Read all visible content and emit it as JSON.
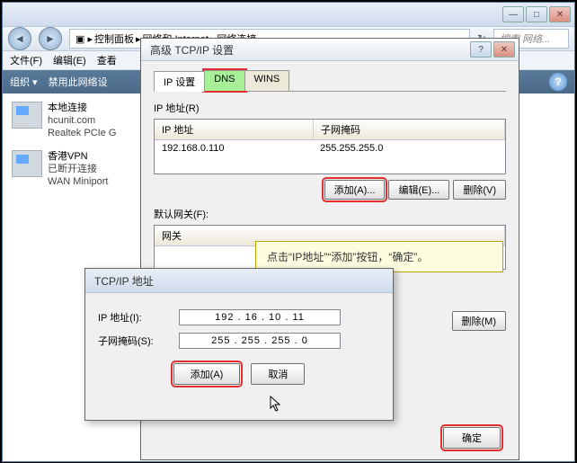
{
  "outer": {
    "crumb": [
      "控制面板",
      "网络和 Internet",
      "网络连接"
    ],
    "search": "搜索 网络...",
    "menus": [
      "文件(F)",
      "编辑(E)",
      "查看"
    ],
    "cmd": [
      "组织 ▾",
      "禁用此网络设"
    ]
  },
  "conns": [
    {
      "name": "本地连接",
      "l1": "hcunit.com",
      "l2": "Realtek PCIe G"
    },
    {
      "name": "香港VPN",
      "l1": "已断开连接",
      "l2": "WAN Miniport"
    }
  ],
  "dlg1": {
    "title": "高级 TCP/IP 设置",
    "tabs": [
      "IP 设置",
      "DNS",
      "WINS"
    ],
    "grp1": "IP 地址(R)",
    "col1": "IP 地址",
    "col2": "子网掩码",
    "ip": "192.168.0.110",
    "mask": "255.255.255.0",
    "btns": [
      "添加(A)...",
      "编辑(E)...",
      "删除(V)"
    ],
    "grp2": "默认网关(F):",
    "gwcol": "网关",
    "gwbtn": "删除(M)",
    "ok": "确定"
  },
  "callout": "点击“IP地址”“添加”按钮，“确定”。",
  "dlg2": {
    "title": "TCP/IP 地址",
    "f1": "IP 地址(I):",
    "v1": "192 . 16 . 10 . 11",
    "f2": "子网掩码(S):",
    "v2": "255 . 255 . 255 .  0",
    "add": "添加(A)",
    "cancel": "取消"
  }
}
